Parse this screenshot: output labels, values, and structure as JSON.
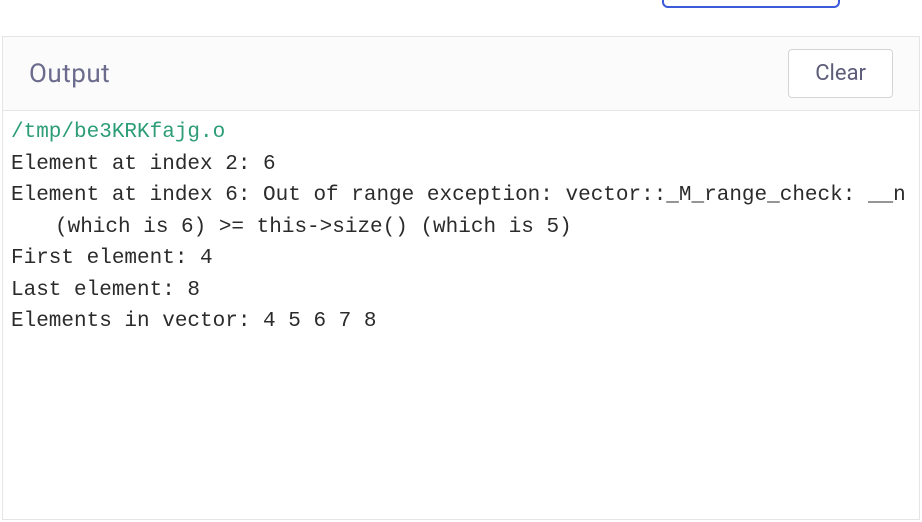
{
  "header": {
    "title": "Output",
    "clear_label": "Clear"
  },
  "output": {
    "path": "/tmp/be3KRKfajg.o",
    "line1": "Element at index 2: 6",
    "line2": "Element at index 6: Out of range exception: vector::_M_range_check: __n ",
    "line2_cont": "(which is 6) >= this->size() (which is 5)",
    "line3": "First element: 4",
    "line4": "Last element: 8",
    "line5": "Elements in vector: 4 5 6 7 8"
  }
}
